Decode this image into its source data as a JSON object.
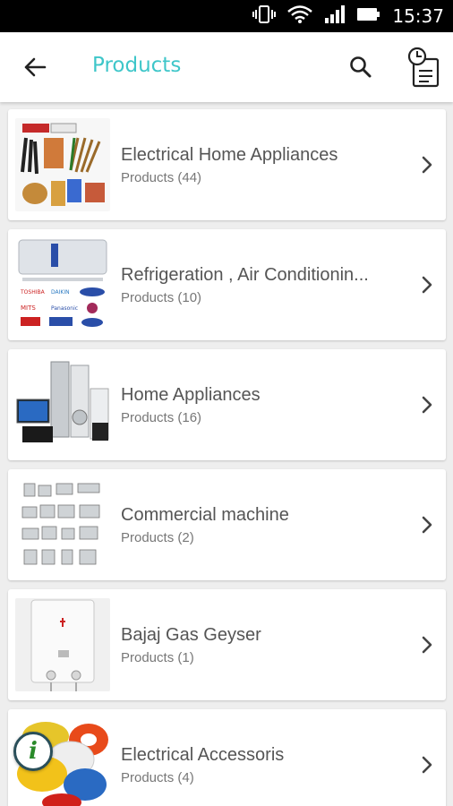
{
  "status_bar": {
    "time": "15:37",
    "icons": [
      "vibrate-icon",
      "wifi-icon",
      "signal-icon",
      "battery-icon"
    ]
  },
  "app_bar": {
    "title": "Products",
    "title_color": "#3ec6c9",
    "icons": [
      "back-arrow-icon",
      "search-icon",
      "history-list-icon"
    ]
  },
  "categories": [
    {
      "name": "Electrical Home Appliances",
      "count": "Products (44)",
      "thumb": "electrical-wires-image"
    },
    {
      "name": "Refrigeration , Air Conditionin...",
      "count": "Products (10)",
      "thumb": "air-conditioner-brands-image"
    },
    {
      "name": "Home Appliances",
      "count": "Products (16)",
      "thumb": "home-appliances-image"
    },
    {
      "name": "Commercial machine",
      "count": "Products (2)",
      "thumb": "commercial-machines-image"
    },
    {
      "name": "Bajaj Gas Geyser",
      "count": "Products (1)",
      "thumb": "gas-geyser-image"
    },
    {
      "name": "Electrical Accessoris",
      "count": "Products (4)",
      "thumb": "cable-spools-image"
    }
  ]
}
